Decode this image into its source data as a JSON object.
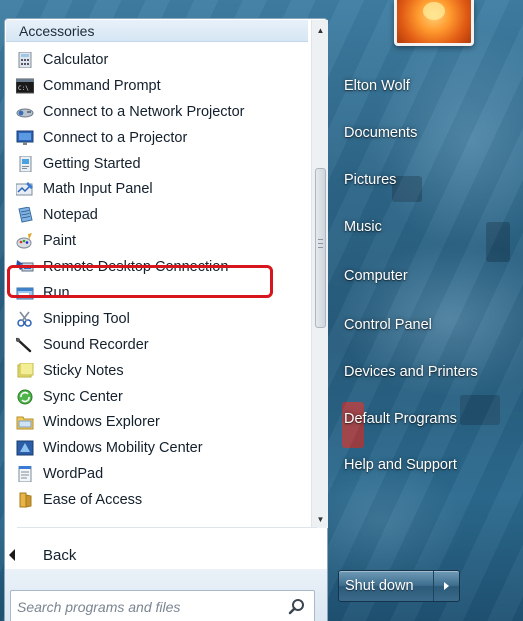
{
  "menu": {
    "group_header": "Accessories",
    "items": [
      {
        "label": "Calculator",
        "icon": "calculator-icon"
      },
      {
        "label": "Command Prompt",
        "icon": "command-prompt-icon"
      },
      {
        "label": "Connect to a Network Projector",
        "icon": "network-projector-icon"
      },
      {
        "label": "Connect to a Projector",
        "icon": "projector-icon"
      },
      {
        "label": "Getting Started",
        "icon": "getting-started-icon"
      },
      {
        "label": "Math Input Panel",
        "icon": "math-input-icon"
      },
      {
        "label": "Notepad",
        "icon": "notepad-icon"
      },
      {
        "label": "Paint",
        "icon": "paint-icon"
      },
      {
        "label": "Remote Desktop Connection",
        "icon": "remote-desktop-icon"
      },
      {
        "label": "Run",
        "icon": "run-icon"
      },
      {
        "label": "Snipping Tool",
        "icon": "snipping-tool-icon"
      },
      {
        "label": "Sound Recorder",
        "icon": "sound-recorder-icon"
      },
      {
        "label": "Sticky Notes",
        "icon": "sticky-notes-icon"
      },
      {
        "label": "Sync Center",
        "icon": "sync-center-icon"
      },
      {
        "label": "Windows Explorer",
        "icon": "windows-explorer-icon"
      },
      {
        "label": "Windows Mobility Center",
        "icon": "mobility-center-icon"
      },
      {
        "label": "WordPad",
        "icon": "wordpad-icon"
      },
      {
        "label": "Ease of Access",
        "icon": "ease-of-access-folder-icon"
      }
    ],
    "highlighted_item": "Remote Desktop Connection",
    "back_label": "Back"
  },
  "search": {
    "placeholder": "Search programs and files"
  },
  "right_pane": {
    "links": [
      {
        "label": "Elton Wolf"
      },
      {
        "label": "Documents"
      },
      {
        "label": "Pictures"
      },
      {
        "label": "Music"
      },
      {
        "label": "Computer"
      },
      {
        "label": "Control Panel"
      },
      {
        "label": "Devices and Printers"
      },
      {
        "label": "Default Programs"
      },
      {
        "label": "Help and Support"
      }
    ],
    "shutdown_label": "Shut down"
  },
  "colors": {
    "highlight_border": "#d6161c",
    "glass_background": "#2d6688",
    "panel_background": "#ffffff"
  }
}
